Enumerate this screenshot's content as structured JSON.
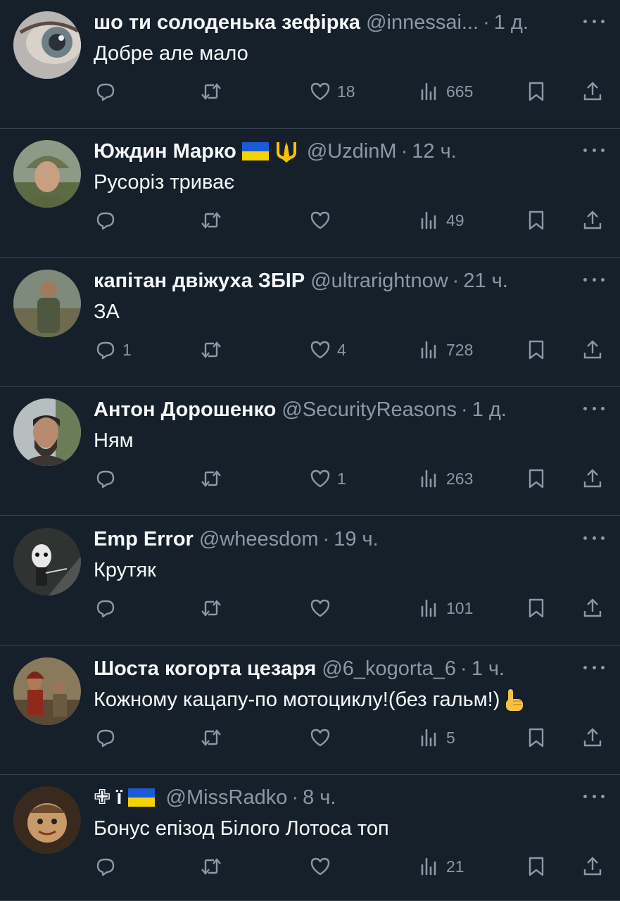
{
  "tweets": [
    {
      "name": "шо ти солоденька зефірка",
      "handle": "@innessai...",
      "time": "1 д.",
      "text": "Добре але мало",
      "replies": "",
      "likes": "18",
      "views": "665"
    },
    {
      "name": "Юждин Марко",
      "handle": "@UzdinM",
      "time": "12 ч.",
      "text": "Русоріз триває",
      "replies": "",
      "likes": "",
      "views": "49"
    },
    {
      "name": "капітан двіжуха ЗБІР",
      "handle": "@ultrarightnow",
      "time": "21 ч.",
      "text": "ЗА",
      "replies": "1",
      "likes": "4",
      "views": "728"
    },
    {
      "name": "Антон Дорошенко",
      "handle": "@SecurityReasons",
      "time": "1 д.",
      "text": "Ням",
      "replies": "",
      "likes": "1",
      "views": "263"
    },
    {
      "name": "Emp Error",
      "handle": "@wheesdom",
      "time": "19 ч.",
      "text": "Крутяк",
      "replies": "",
      "likes": "",
      "views": "101"
    },
    {
      "name": "Шоста когорта цезаря",
      "handle": "@6_kogorta_6",
      "time": "1 ч.",
      "text": "Кожному кацапу-по мотоциклу!(без гальм!)",
      "replies": "",
      "likes": "",
      "views": "5"
    },
    {
      "name": "✙ ї",
      "handle": "@MissRadko",
      "time": "8 ч.",
      "text": "Бонус епізод Білого Лотоса топ",
      "replies": "",
      "likes": "",
      "views": "21"
    }
  ],
  "separator": "·",
  "icons": {
    "reply": "reply-icon",
    "retweet": "retweet-icon",
    "like": "heart-icon",
    "views": "views-icon",
    "bookmark": "bookmark-icon",
    "share": "share-icon",
    "more": "more-icon"
  },
  "colors": {
    "background": "#15202b",
    "text": "#f7f9f9",
    "secondary": "#8b98a5",
    "divider": "#38444d"
  }
}
